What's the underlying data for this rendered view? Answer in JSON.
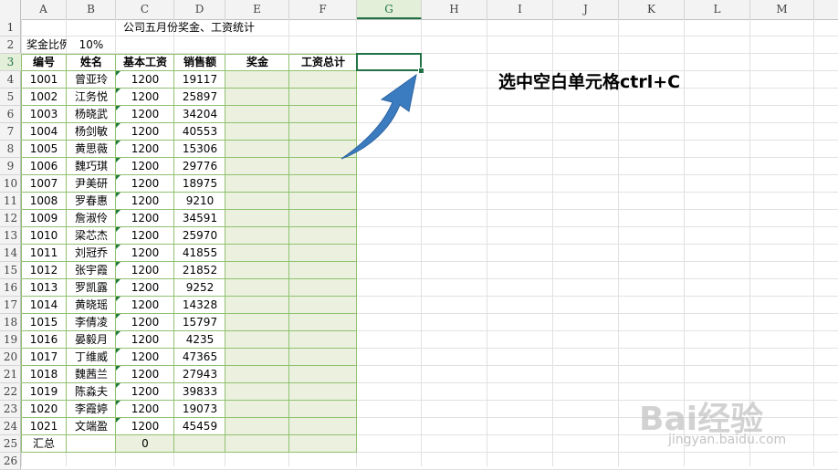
{
  "columns": [
    "A",
    "B",
    "C",
    "D",
    "E",
    "F",
    "G",
    "H",
    "I",
    "J",
    "K",
    "L",
    "M"
  ],
  "active_column": "G",
  "active_row": "3",
  "rows": [
    "1",
    "2",
    "3",
    "4",
    "5",
    "6",
    "7",
    "8",
    "9",
    "10",
    "11",
    "12",
    "13",
    "14",
    "15",
    "16",
    "17",
    "18",
    "19",
    "20",
    "21",
    "22",
    "23",
    "24",
    "25",
    "26"
  ],
  "title": "公司五月份奖金、工资统计",
  "bonus_ratio_label": "奖金比例",
  "bonus_ratio_value": "10%",
  "headers": [
    "编号",
    "姓名",
    "基本工资",
    "销售额",
    "奖金",
    "工资总计"
  ],
  "records": [
    [
      "1001",
      "曾亚玲",
      "1200",
      "19117"
    ],
    [
      "1002",
      "江务悦",
      "1200",
      "25897"
    ],
    [
      "1003",
      "杨晓武",
      "1200",
      "34204"
    ],
    [
      "1004",
      "杨剑敏",
      "1200",
      "40553"
    ],
    [
      "1005",
      "黄思薇",
      "1200",
      "15306"
    ],
    [
      "1006",
      "魏巧琪",
      "1200",
      "29776"
    ],
    [
      "1007",
      "尹美研",
      "1200",
      "18975"
    ],
    [
      "1008",
      "罗春惠",
      "1200",
      "9210"
    ],
    [
      "1009",
      "詹淑伶",
      "1200",
      "34591"
    ],
    [
      "1010",
      "梁芯杰",
      "1200",
      "25970"
    ],
    [
      "1011",
      "刘冠乔",
      "1200",
      "41855"
    ],
    [
      "1012",
      "张宇霞",
      "1200",
      "21852"
    ],
    [
      "1013",
      "罗凯露",
      "1200",
      "9252"
    ],
    [
      "1014",
      "黄晓瑶",
      "1200",
      "14328"
    ],
    [
      "1015",
      "李倩凌",
      "1200",
      "15797"
    ],
    [
      "1016",
      "晏毅月",
      "1200",
      "4235"
    ],
    [
      "1017",
      "丁维威",
      "1200",
      "47365"
    ],
    [
      "1018",
      "魏茜兰",
      "1200",
      "27943"
    ],
    [
      "1019",
      "陈淼夫",
      "1200",
      "39833"
    ],
    [
      "1020",
      "李霞婷",
      "1200",
      "19073"
    ],
    [
      "1021",
      "文端盈",
      "1200",
      "45459"
    ]
  ],
  "total_label": "汇总",
  "total_value": "0",
  "instruction": "选中空白单元格ctrl+C",
  "watermark_logo": "Bai经验",
  "watermark_url": "jingyan.baidu.com",
  "colors": {
    "accent": "#217346",
    "table_border": "#8fc16f",
    "fill": "#ebf1de",
    "arrow": "#3b7bbf"
  },
  "icons": {
    "arrow": "curved-arrow-icon"
  }
}
